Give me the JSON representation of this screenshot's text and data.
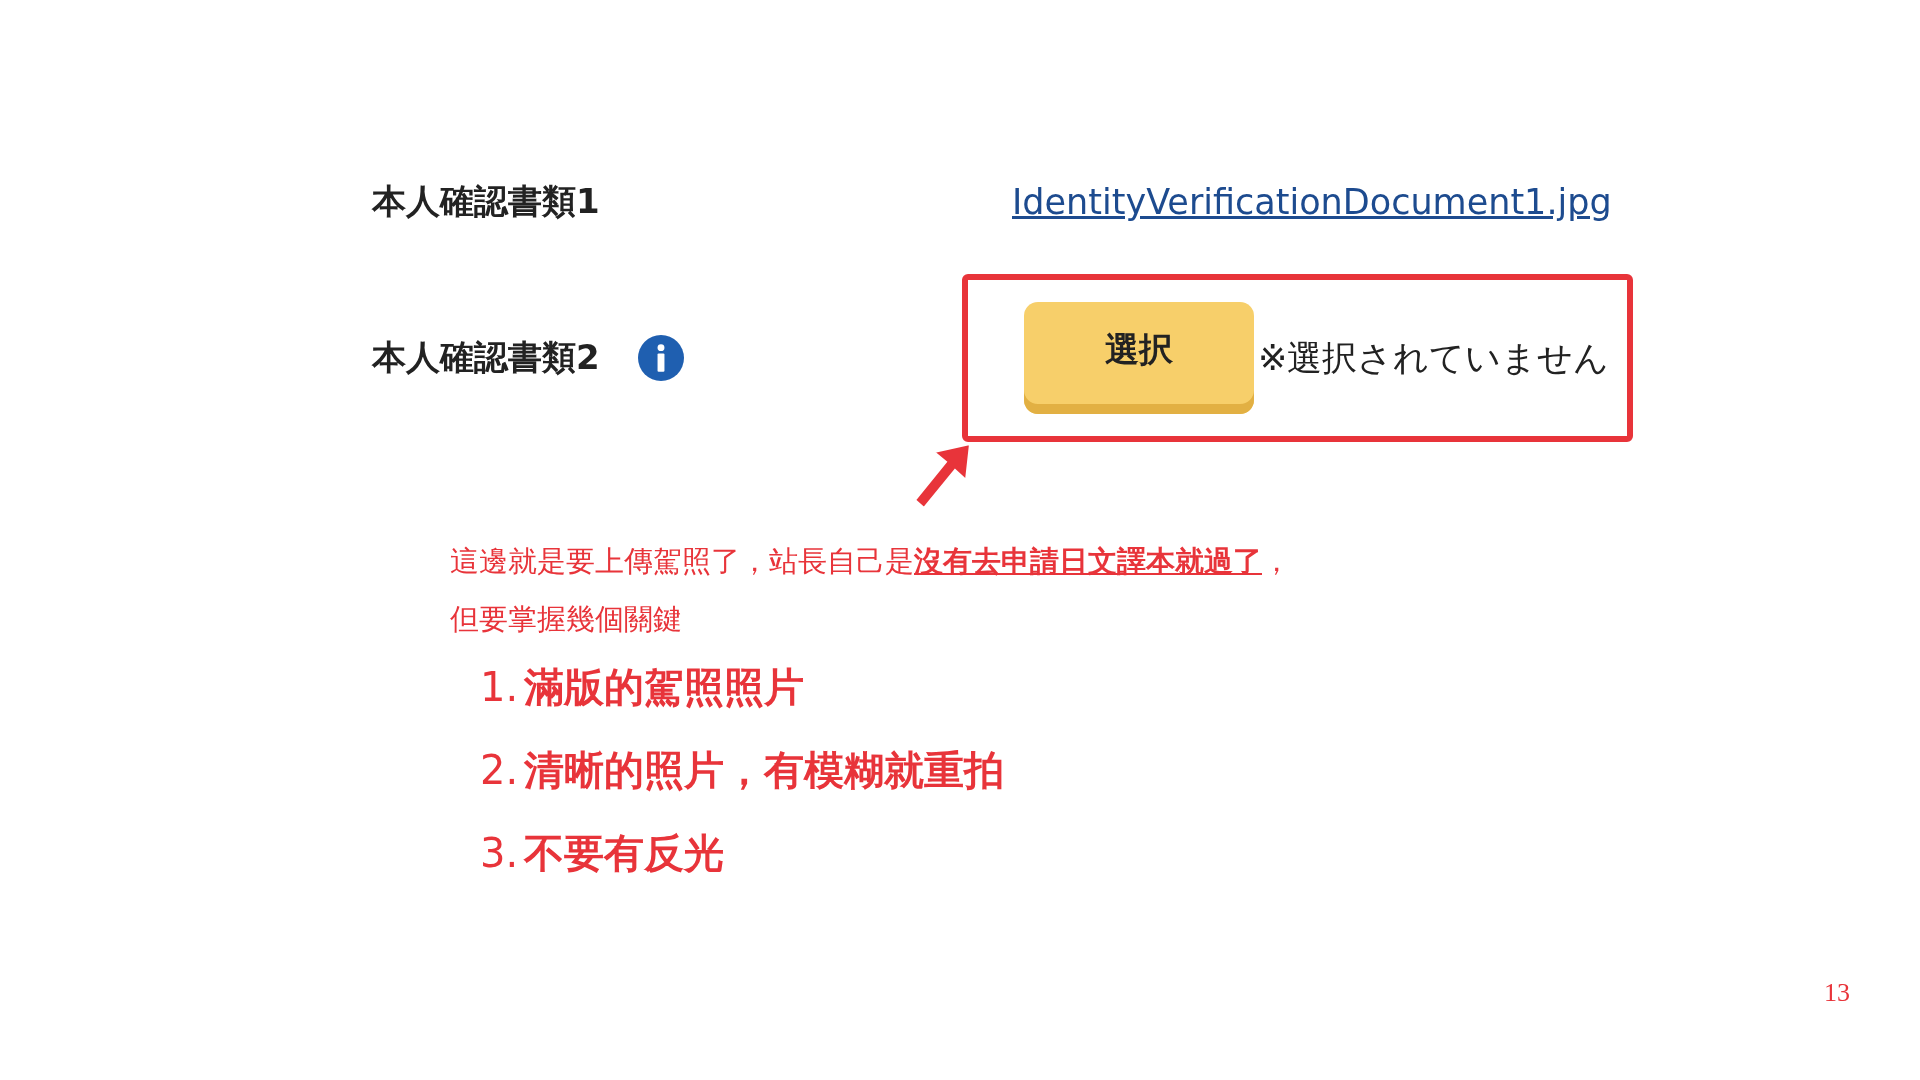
{
  "form": {
    "rows": [
      {
        "label": "本人確認書類1",
        "kind": "file",
        "value": "IdentityVerificationDocument1.jpg"
      },
      {
        "label": "本人確認書類2",
        "kind": "picker",
        "info": true,
        "button": "選択",
        "status": "※選択されていません",
        "highlighted": true
      }
    ]
  },
  "note": {
    "lines": [
      "這邊就是要上傳駕照了，站長自己是**沒有去申請日文譯本就過了**，",
      "但要掌握幾個關鍵"
    ],
    "items": [
      {
        "number": "1.",
        "text": "滿版的駕照照片"
      },
      {
        "number": "2.",
        "text": "清晰的照片，有模糊就重拍"
      },
      {
        "number": "3.",
        "text": "不要有反光"
      }
    ]
  },
  "page_number": "13"
}
